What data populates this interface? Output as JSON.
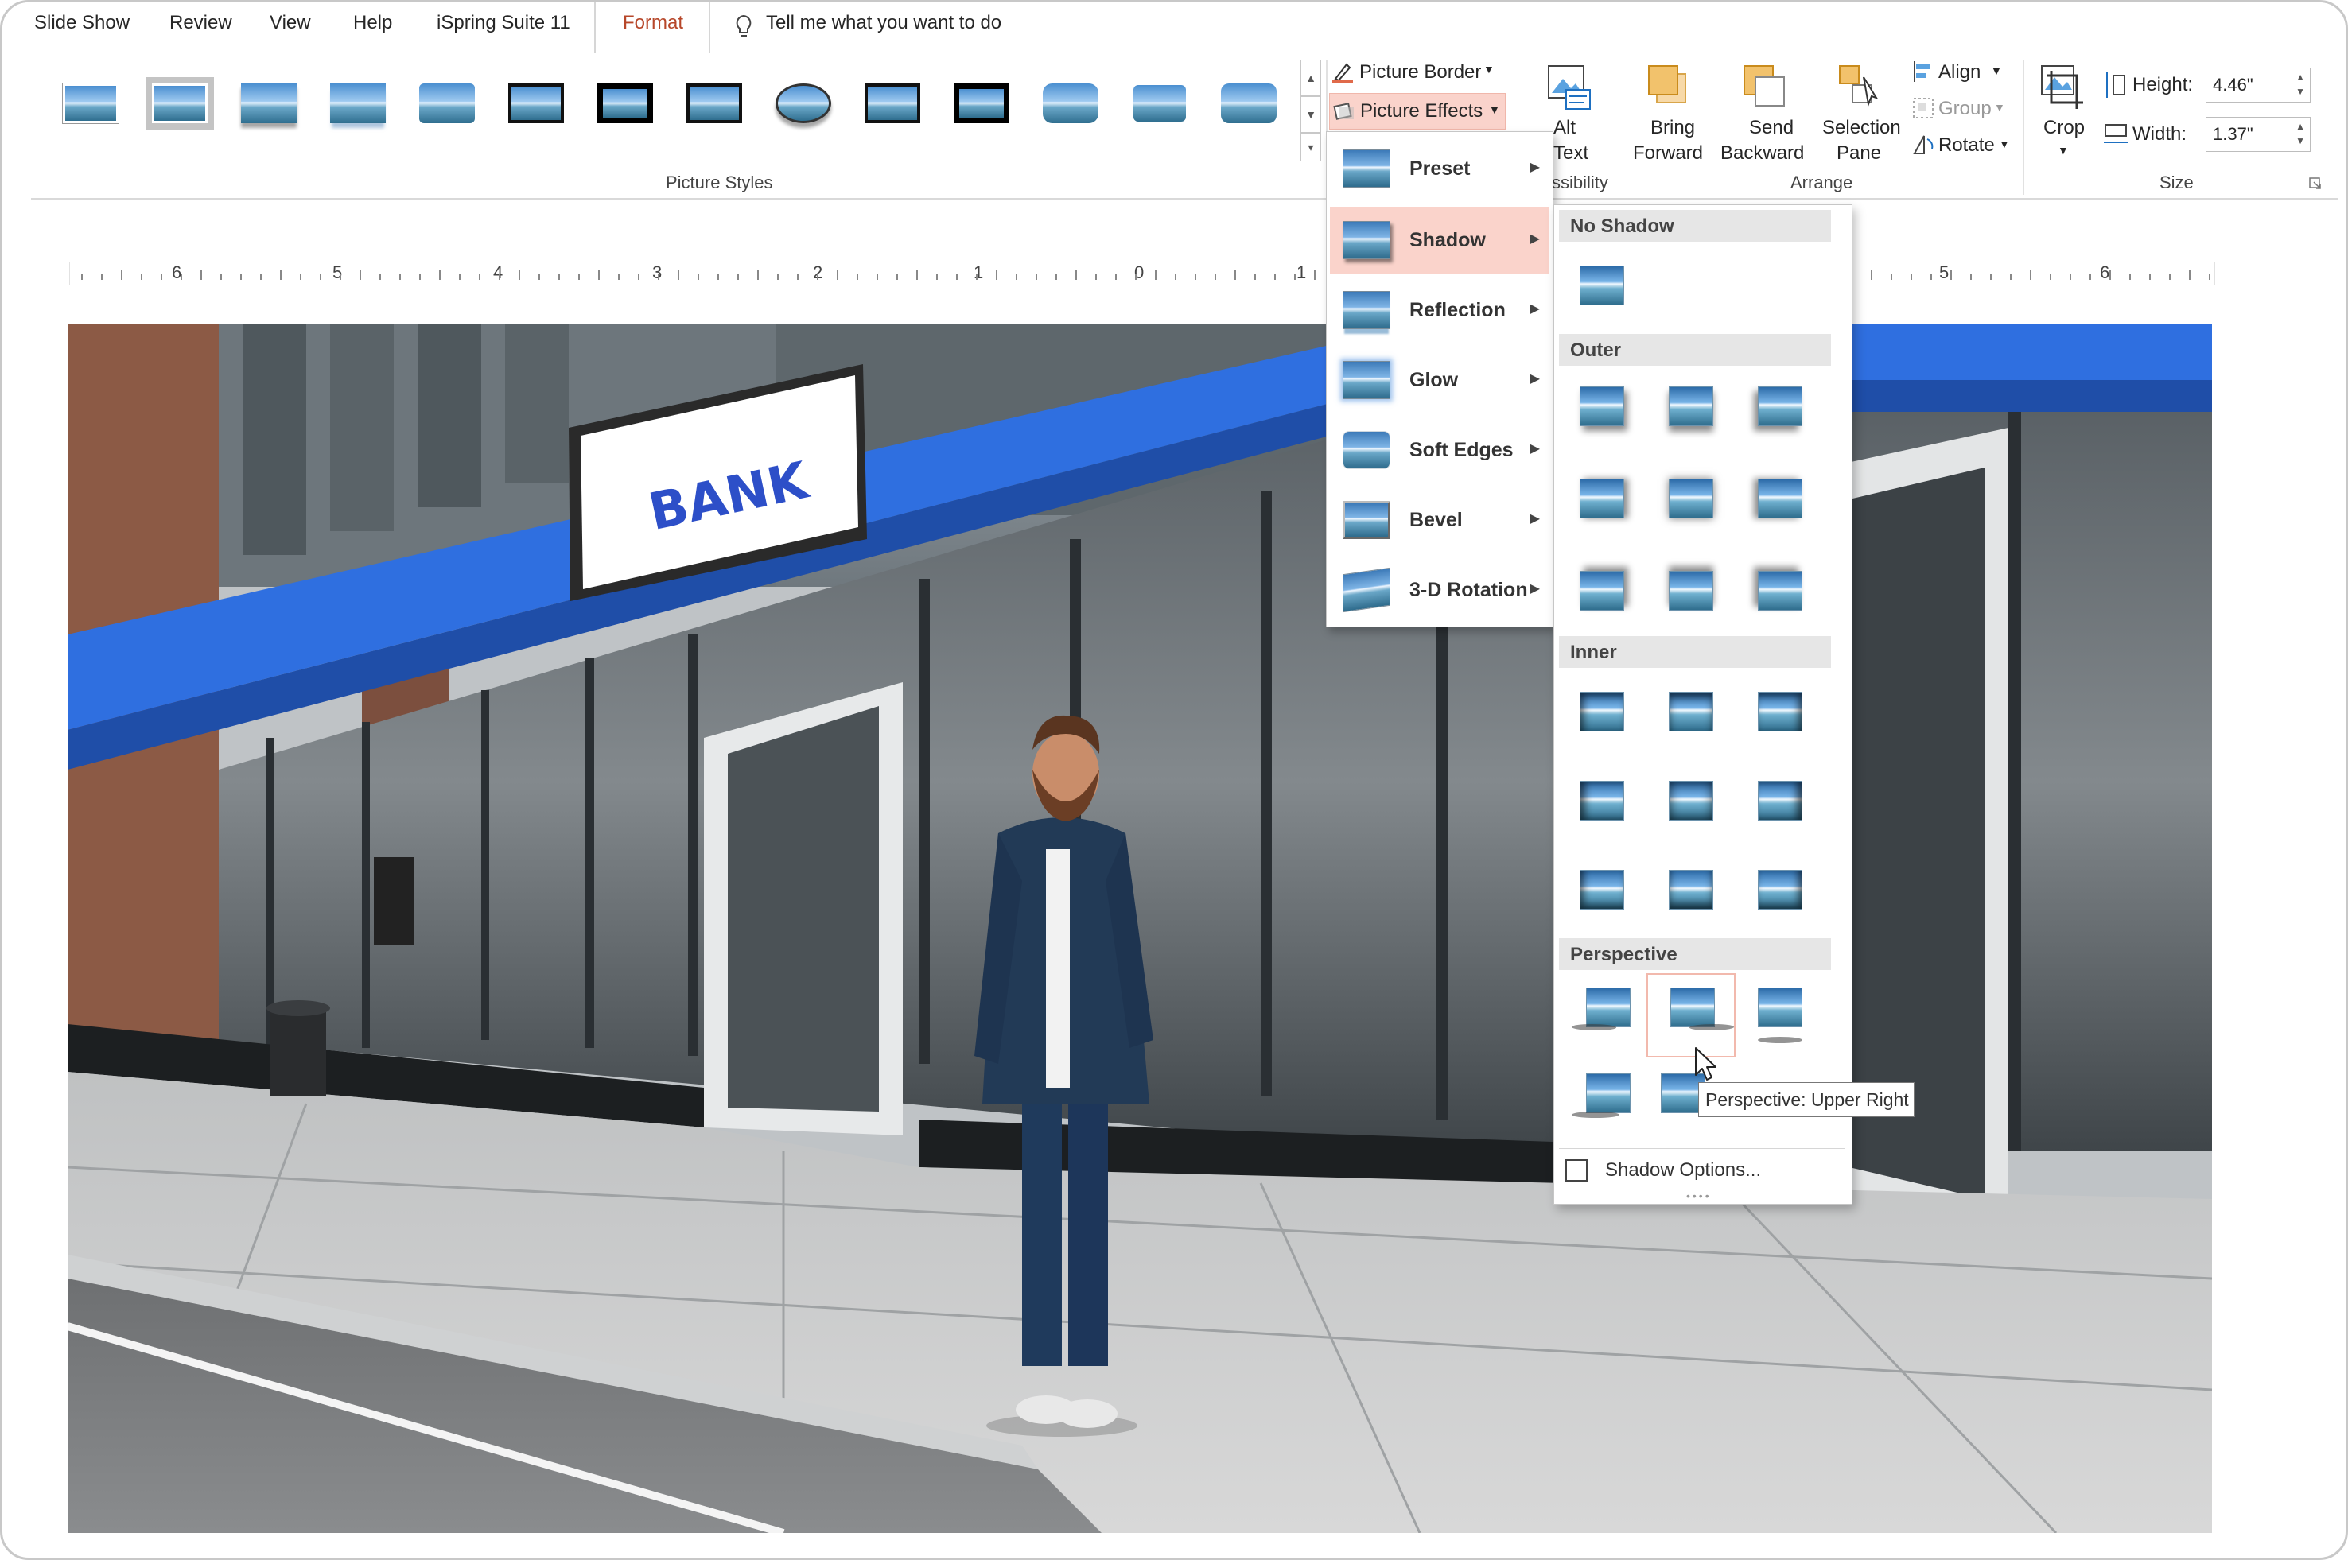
{
  "tabs": [
    {
      "label": "Slide Show"
    },
    {
      "label": "Review"
    },
    {
      "label": "View"
    },
    {
      "label": "Help"
    },
    {
      "label": "iSpring Suite 11"
    },
    {
      "label": "Format",
      "active": true
    }
  ],
  "tell_me": "Tell me what you want to do",
  "ribbon": {
    "picture_styles_label": "Picture Styles",
    "picture_border": "Picture Border",
    "picture_effects": "Picture Effects",
    "alt_text_line1": "Alt",
    "alt_text_line2": "Text",
    "accessibility_label": "ssibility",
    "bring_forward_line1": "Bring",
    "bring_forward_line2": "Forward",
    "send_backward_line1": "Send",
    "send_backward_line2": "Backward",
    "selection_pane_line1": "Selection",
    "selection_pane_line2": "Pane",
    "arrange_label": "Arrange",
    "align": "Align",
    "group": "Group",
    "rotate": "Rotate",
    "crop": "Crop",
    "height_label": "Height:",
    "height_value": "4.46\"",
    "width_label": "Width:",
    "width_value": "1.37\"",
    "size_label": "Size"
  },
  "ruler": {
    "numbers": [
      "6",
      "5",
      "4",
      "3",
      "2",
      "1",
      "0",
      "1",
      "5",
      "6"
    ]
  },
  "slide": {
    "sign_text": "BANK"
  },
  "effects_menu": {
    "items": [
      {
        "label": "Preset"
      },
      {
        "label": "Shadow",
        "active": true
      },
      {
        "label": "Reflection"
      },
      {
        "label": "Glow"
      },
      {
        "label": "Soft Edges"
      },
      {
        "label": "Bevel"
      },
      {
        "label": "3-D Rotation"
      }
    ]
  },
  "shadow_menu": {
    "no_shadow": "No Shadow",
    "outer": "Outer",
    "inner": "Inner",
    "perspective": "Perspective",
    "shadow_options": "Shadow Options..."
  },
  "tooltip": "Perspective: Upper Right",
  "colors": {
    "accent": "#b7472a",
    "highlight": "#fad3cb"
  }
}
